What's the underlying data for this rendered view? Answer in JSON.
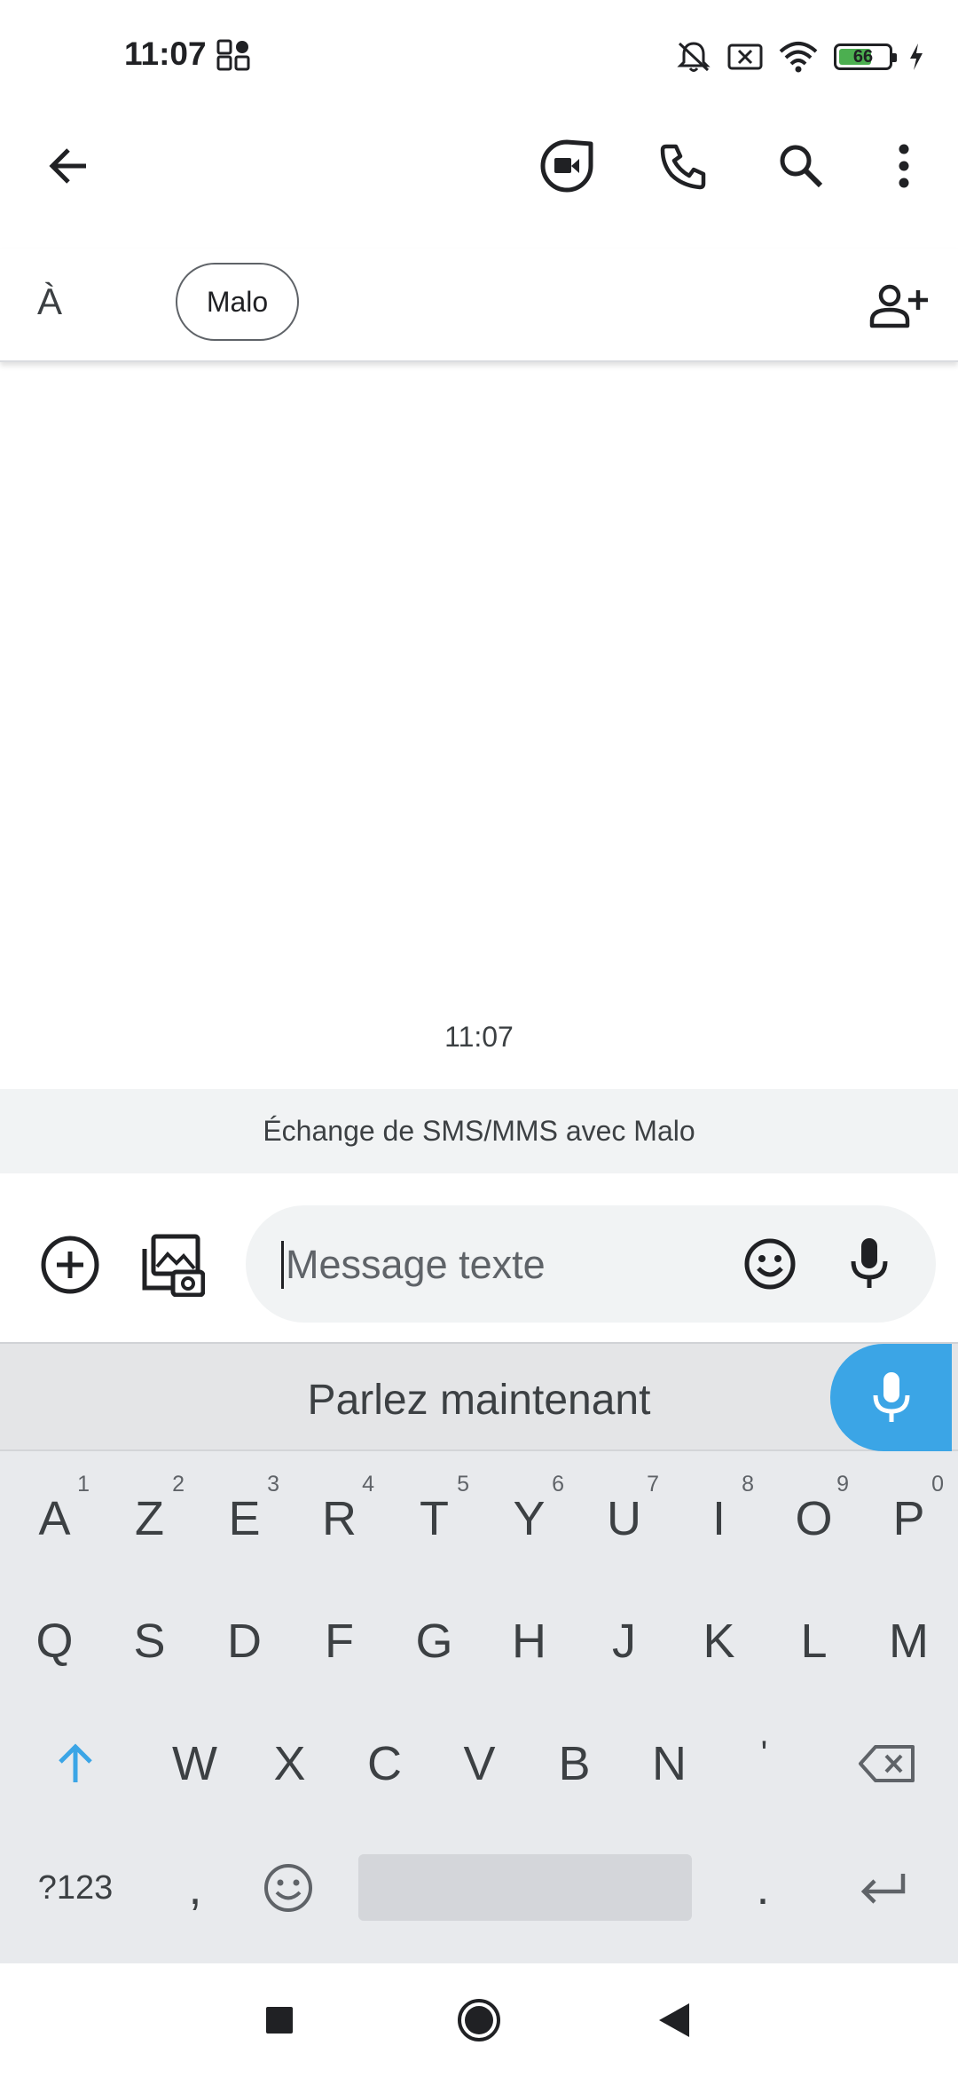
{
  "status": {
    "time": "11:07",
    "battery_level": "66",
    "battery_fraction": 0.66
  },
  "app_bar": {
    "icons": [
      "back-arrow-icon",
      "video-call-icon",
      "phone-icon",
      "search-icon",
      "more-vert-icon"
    ]
  },
  "recipients": {
    "to_label": "À",
    "chips": [
      "Malo"
    ]
  },
  "conversation": {
    "timestamp": "11:07",
    "sms_banner": "Échange de SMS/MMS avec Malo"
  },
  "compose": {
    "placeholder": "Message texte"
  },
  "keyboard": {
    "voice_prompt": "Parlez maintenant",
    "row1": [
      {
        "key": "A",
        "hint": "1"
      },
      {
        "key": "Z",
        "hint": "2"
      },
      {
        "key": "E",
        "hint": "3"
      },
      {
        "key": "R",
        "hint": "4"
      },
      {
        "key": "T",
        "hint": "5"
      },
      {
        "key": "Y",
        "hint": "6"
      },
      {
        "key": "U",
        "hint": "7"
      },
      {
        "key": "I",
        "hint": "8"
      },
      {
        "key": "O",
        "hint": "9"
      },
      {
        "key": "P",
        "hint": "0"
      }
    ],
    "row2": [
      "Q",
      "S",
      "D",
      "F",
      "G",
      "H",
      "J",
      "K",
      "L",
      "M"
    ],
    "row3": [
      "W",
      "X",
      "C",
      "V",
      "B",
      "N",
      "'"
    ],
    "bottom": {
      "symbols": "?123",
      "comma": ",",
      "period": "."
    }
  },
  "colors": {
    "accent": "#3ba5e6",
    "keyboard_bg": "#e8eaed"
  }
}
